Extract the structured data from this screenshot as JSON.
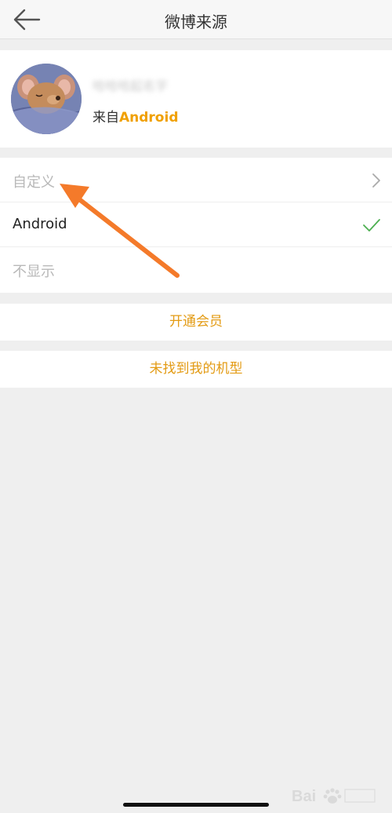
{
  "header": {
    "title": "微博来源",
    "back_icon": "back-arrow-icon"
  },
  "profile": {
    "username": "哈哈哈起名字",
    "source_prefix": "来自",
    "source_value": "Android"
  },
  "options": [
    {
      "label": "自定义",
      "trailing": "chevron-right-icon",
      "style": "dim"
    },
    {
      "label": "Android",
      "trailing": "check-icon",
      "style": "dark",
      "selected": true
    },
    {
      "label": "不显示",
      "trailing": "",
      "style": "dim"
    }
  ],
  "actions": {
    "open_vip": "开通会员",
    "model_not_found": "未找到我的机型"
  },
  "colors": {
    "accent": "#f0a000",
    "action_text": "#e39b14",
    "check": "#4caf50",
    "annotation": "#f47a2a"
  }
}
